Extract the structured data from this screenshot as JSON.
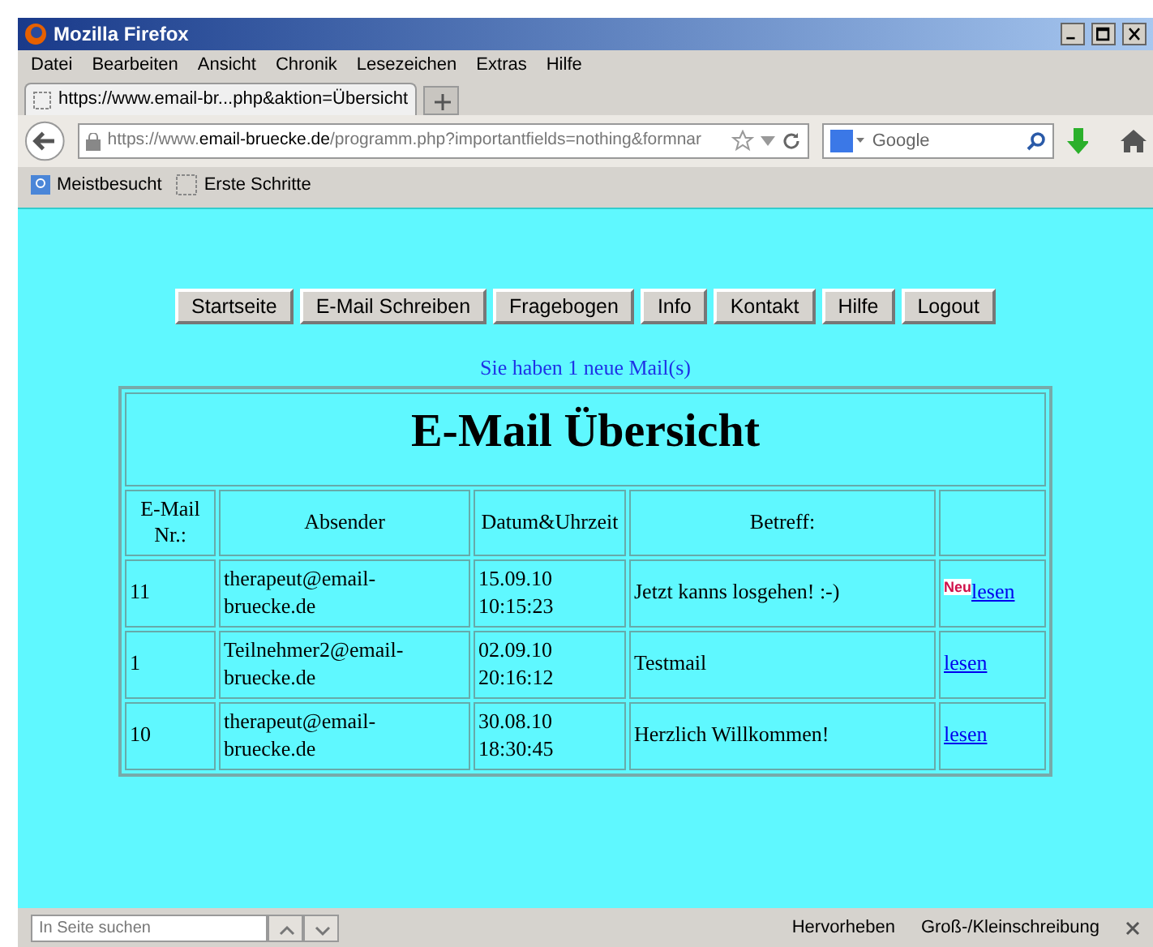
{
  "window": {
    "title": "Mozilla Firefox"
  },
  "menu": [
    "Datei",
    "Bearbeiten",
    "Ansicht",
    "Chronik",
    "Lesezeichen",
    "Extras",
    "Hilfe"
  ],
  "tabs": [
    {
      "label": "https://www.email-br...php&aktion=Übersicht",
      "selected": true
    }
  ],
  "address": {
    "prefix": "https://www.",
    "domain": "email-bruecke.de",
    "path": "/programm.php?importantfields=nothing&formnar"
  },
  "search": {
    "placeholder": "Google"
  },
  "bookmarks": [
    "Meistbesucht",
    "Erste Schritte"
  ],
  "nav_buttons": [
    "Startseite",
    "E-Mail Schreiben",
    "Fragebogen",
    "Info",
    "Kontakt",
    "Hilfe",
    "Logout"
  ],
  "notice": "Sie haben 1 neue Mail(s)",
  "table": {
    "title": "E-Mail Übersicht",
    "columns": [
      "E-Mail Nr.:",
      "Absender",
      "Datum&Uhrzeit",
      "Betreff:"
    ],
    "rows": [
      {
        "nr": "11",
        "sender": "therapeut@email-bruecke.de",
        "date": "15.09.10",
        "time": "10:15:23",
        "subject": "Jetzt kanns losgehen! :-)",
        "badge": "Neu",
        "link": "lesen"
      },
      {
        "nr": "1",
        "sender": "Teilnehmer2@email-bruecke.de",
        "date": "02.09.10",
        "time": "20:16:12",
        "subject": "Testmail",
        "link": "lesen"
      },
      {
        "nr": "10",
        "sender": "therapeut@email-bruecke.de",
        "date": "30.08.10",
        "time": "18:30:45",
        "subject": "Herzlich Willkommen!",
        "link": "lesen"
      }
    ]
  },
  "find_bar": {
    "placeholder": "In Seite suchen",
    "options": [
      "Hervorheben",
      "Groß-/Kleinschreibung"
    ]
  }
}
